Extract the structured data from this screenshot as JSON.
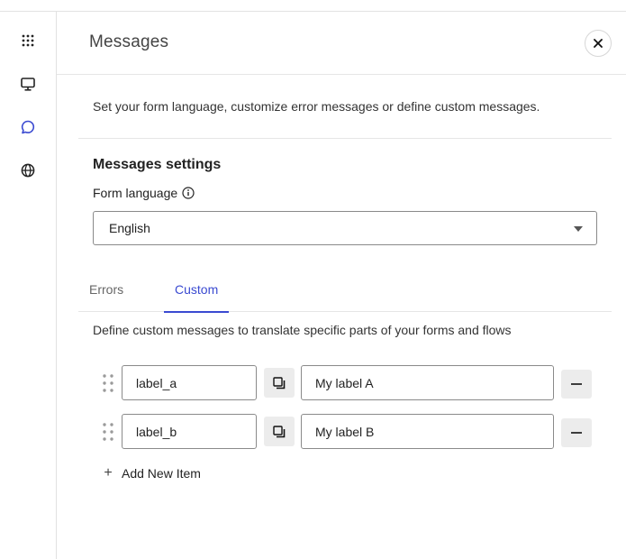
{
  "panel": {
    "title": "Messages",
    "intro": "Set your form language, customize error messages or define custom messages."
  },
  "rail": {
    "items": [
      {
        "icon": "apps-grid-icon"
      },
      {
        "icon": "monitor-icon"
      },
      {
        "icon": "chat-bubble-icon",
        "active": true
      },
      {
        "icon": "globe-icon"
      }
    ]
  },
  "settings": {
    "title": "Messages settings",
    "language_label": "Form language",
    "language_value": "English"
  },
  "tabs": [
    {
      "label": "Errors",
      "active": false
    },
    {
      "label": "Custom",
      "active": true
    }
  ],
  "custom": {
    "description": "Define custom messages to translate specific parts of your forms and flows",
    "items": [
      {
        "key": "label_a",
        "value": "My label A"
      },
      {
        "key": "label_b",
        "value": "My label B"
      }
    ],
    "add_label": "Add New Item",
    "add_symbol": "+"
  },
  "colors": {
    "accent": "#3a4ad1",
    "border": "#8a8a8a",
    "button_bg": "#ececec"
  }
}
